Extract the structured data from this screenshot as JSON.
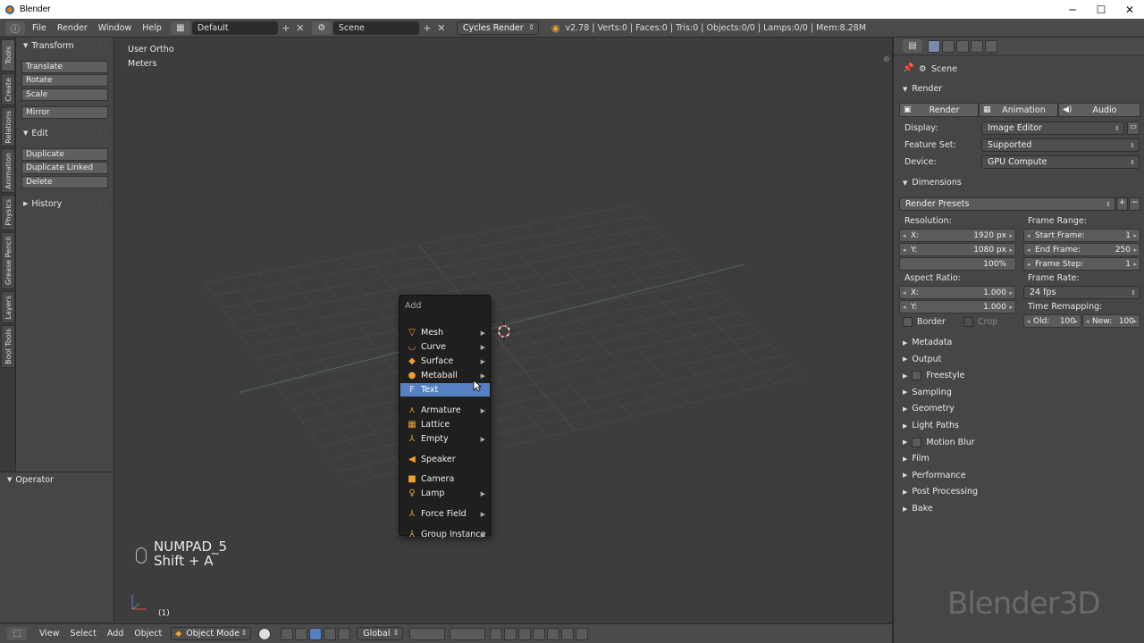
{
  "window": {
    "title": "Blender",
    "min": "─",
    "max": "☐",
    "close": "✕"
  },
  "menubar": {
    "items": [
      "File",
      "Render",
      "Window",
      "Help"
    ],
    "layout": "Default",
    "scene": "Scene",
    "engine": "Cycles Render",
    "stats": "v2.78 | Verts:0 | Faces:0 | Tris:0 | Objects:0/0 | Lamps:0/0 | Mem:8.28M"
  },
  "shelf_tabs": [
    "Tools",
    "Create",
    "Relations",
    "Animation",
    "Physics",
    "Grease Pencil",
    "Layers",
    "Bool Tools"
  ],
  "tools": {
    "transform_header": "Transform",
    "transform_buttons": [
      "Translate",
      "Rotate",
      "Scale"
    ],
    "mirror": "Mirror",
    "edit_header": "Edit",
    "edit_buttons": [
      "Duplicate",
      "Duplicate Linked",
      "Delete"
    ],
    "history_header": "History",
    "operator_header": "Operator"
  },
  "viewport": {
    "view_name": "User Ortho",
    "units": "Meters",
    "key1": "NUMPAD_5",
    "key2": "Shift + A",
    "frame": "(1)"
  },
  "add_menu": {
    "title": "Add",
    "items": [
      {
        "label": "Mesh",
        "icon": "▽"
      },
      {
        "label": "Curve",
        "icon": "◡"
      },
      {
        "label": "Surface",
        "icon": "◆"
      },
      {
        "label": "Metaball",
        "icon": "●"
      },
      {
        "label": "Text",
        "icon": "F"
      },
      {
        "label": "Armature",
        "icon": "⋏"
      },
      {
        "label": "Lattice",
        "icon": "▦"
      },
      {
        "label": "Empty",
        "icon": "⅄"
      },
      {
        "label": "Speaker",
        "icon": "◀"
      },
      {
        "label": "Camera",
        "icon": "■"
      },
      {
        "label": "Lamp",
        "icon": "♀"
      },
      {
        "label": "Force Field",
        "icon": "⅄"
      },
      {
        "label": "Group Instance",
        "icon": "⅄"
      }
    ]
  },
  "bottombar": {
    "items": [
      "View",
      "Select",
      "Add",
      "Object"
    ],
    "mode": "Object Mode",
    "orientation": "Global"
  },
  "properties": {
    "context": "Scene",
    "render_header": "Render",
    "render_btn": "Render",
    "animation_btn": "Animation",
    "audio_btn": "Audio",
    "display_label": "Display:",
    "display_value": "Image Editor",
    "feature_label": "Feature Set:",
    "feature_value": "Supported",
    "device_label": "Device:",
    "device_value": "GPU Compute",
    "dimensions_header": "Dimensions",
    "presets": "Render Presets",
    "resolution_label": "Resolution:",
    "res_x_label": "X:",
    "res_x": "1920 px",
    "res_y_label": "Y:",
    "res_y": "1080 px",
    "res_pct": "100%",
    "frame_range_label": "Frame Range:",
    "start_label": "Start Frame:",
    "start": "1",
    "end_label": "End Frame:",
    "end": "250",
    "step_label": "Frame Step:",
    "step": "1",
    "aspect_label": "Aspect Ratio:",
    "asp_x_label": "X:",
    "asp_x": "1.000",
    "asp_y_label": "Y:",
    "asp_y": "1.000",
    "frame_rate_label": "Frame Rate:",
    "fps": "24 fps",
    "remap_label": "Time Remapping:",
    "old_label": "Old:",
    "old": "100",
    "new_label": "New:",
    "new": "100",
    "border": "Border",
    "crop": "Crop",
    "sections": [
      {
        "label": "Metadata",
        "check": false
      },
      {
        "label": "Output",
        "check": false
      },
      {
        "label": "Freestyle",
        "check": true
      },
      {
        "label": "Sampling",
        "check": false
      },
      {
        "label": "Geometry",
        "check": false
      },
      {
        "label": "Light Paths",
        "check": false
      },
      {
        "label": "Motion Blur",
        "check": true
      },
      {
        "label": "Film",
        "check": false
      },
      {
        "label": "Performance",
        "check": false
      },
      {
        "label": "Post Processing",
        "check": false
      },
      {
        "label": "Bake",
        "check": false
      }
    ]
  },
  "watermark": "Blender3D"
}
